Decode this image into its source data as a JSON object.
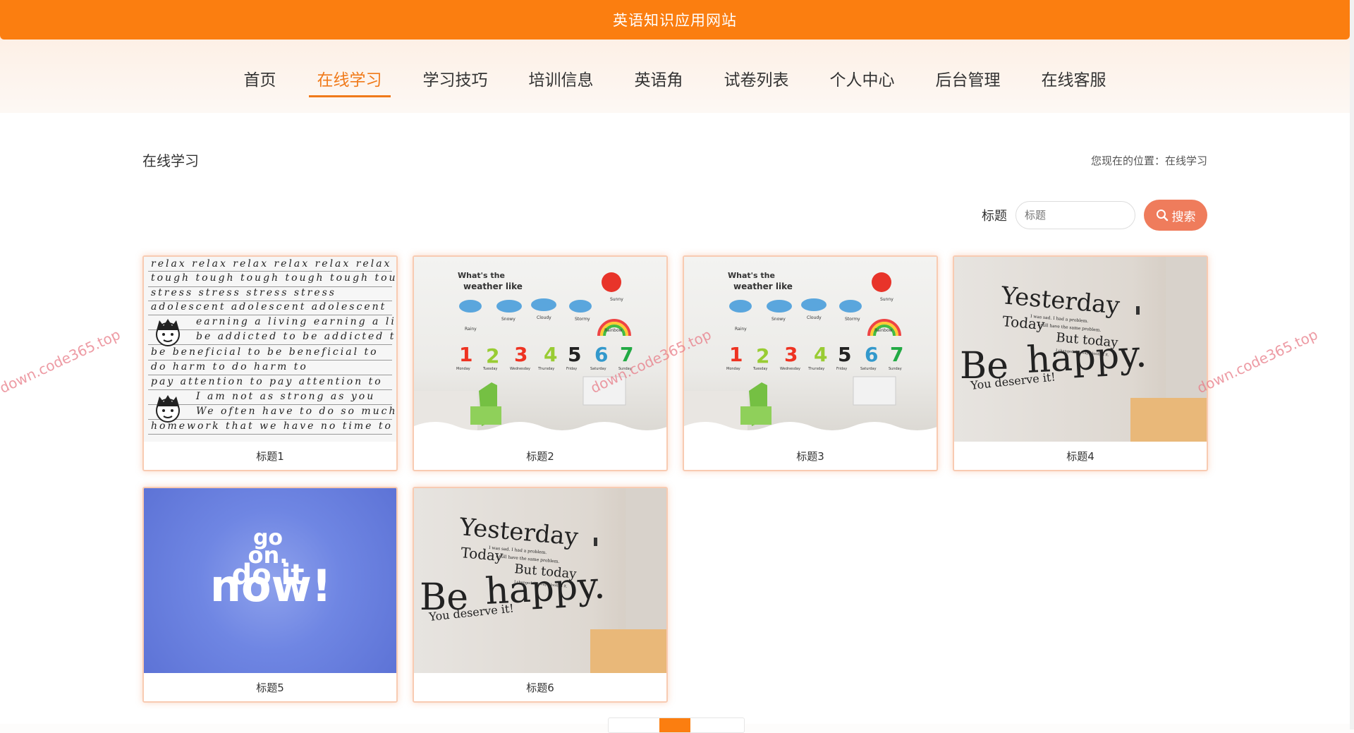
{
  "header": {
    "title": "英语知识应用网站"
  },
  "nav": {
    "items": [
      {
        "label": "首页"
      },
      {
        "label": "在线学习",
        "active": true
      },
      {
        "label": "学习技巧"
      },
      {
        "label": "培训信息"
      },
      {
        "label": "英语角"
      },
      {
        "label": "试卷列表"
      },
      {
        "label": "个人中心"
      },
      {
        "label": "后台管理"
      },
      {
        "label": "在线客服"
      }
    ]
  },
  "page": {
    "section_title": "在线学习",
    "breadcrumb": "您现在的位置：在线学习"
  },
  "search": {
    "label": "标题",
    "placeholder": "标题",
    "button_label": "搜索"
  },
  "cards": [
    {
      "title": "标题1",
      "image": "handwriting-practice"
    },
    {
      "title": "标题2",
      "image": "weather-wall-stickers"
    },
    {
      "title": "标题3",
      "image": "weather-wall-stickers"
    },
    {
      "title": "标题4",
      "image": "be-happy-wall-quote"
    },
    {
      "title": "标题5",
      "image": "go-on-do-it-now"
    },
    {
      "title": "标题6",
      "image": "be-happy-wall-quote"
    }
  ],
  "images": {
    "handwriting_lines": [
      "relax relax relax relax relax relax",
      "tough tough tough tough tough tough",
      "stress stress stress stress",
      "adolescent adolescent adolescent",
      "earning a living earning a living",
      "be addicted to be addicted to",
      "be beneficial to be beneficial to",
      "do harm to do harm to",
      "pay attention to pay attention to",
      "I am not as strong as you",
      "We often have to do so much",
      "homework that we have no time to"
    ],
    "weather": {
      "heading_line1": "What's the",
      "heading_line2": "weather like",
      "sun": "Sunny",
      "clouds": [
        "Snowy",
        "Cloudy",
        "Stormy"
      ],
      "rainy": "Rainy",
      "rainbow": "Rainbow",
      "numbers": [
        "1",
        "2",
        "3",
        "4",
        "5",
        "6",
        "7"
      ],
      "days": [
        "Monday",
        "Tuesday",
        "Wednesday",
        "Thursday",
        "Friday",
        "Saturday",
        "Sunday"
      ]
    },
    "quote": {
      "yesterday": "Yesterday",
      "line2": "I was sad. I had a problem.",
      "today": "Today",
      "line3": "I still have the same problem.",
      "but_today": "But today",
      "line4": "I changed the way I look at it.",
      "be": "Be",
      "happy": "happy.",
      "deserve": "You deserve it!"
    },
    "motivation": {
      "line1": "go",
      "line2": "on.",
      "line3": "do it",
      "line4": "now!"
    }
  },
  "watermark": "down.code365.top",
  "colors": {
    "brand": "#fb7e10",
    "accent_button": "#ef7c5c",
    "nav_active": "#f07a1a"
  }
}
